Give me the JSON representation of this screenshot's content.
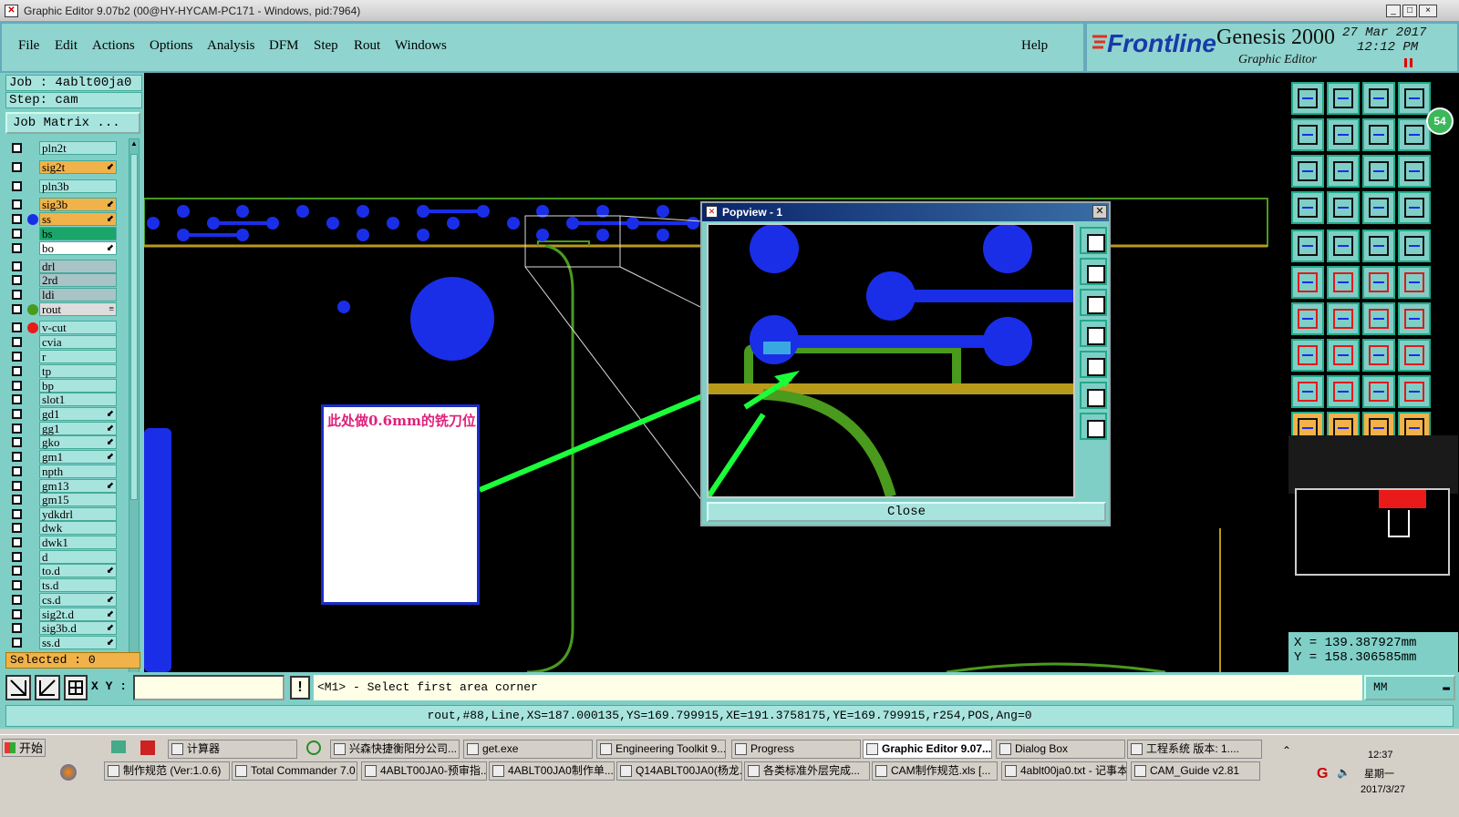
{
  "window": {
    "title": "Graphic Editor 9.07b2 (00@HY-HYCAM-PC171 - Windows, pid:7964)",
    "controls": [
      "_",
      "□",
      "×"
    ]
  },
  "menu": {
    "items": [
      "File",
      "Edit",
      "Actions",
      "Options",
      "Analysis",
      "DFM",
      "Step",
      "Rout",
      "Windows"
    ],
    "help": "Help"
  },
  "brand": {
    "logo": "Frontline",
    "product": "Genesis 2000",
    "subtitle": "Graphic Editor",
    "date": "27 Mar 2017",
    "time": "12:12 PM"
  },
  "job": {
    "job_label": "Job : 4ablt00ja0",
    "step_label": "Step: cam",
    "matrix_button": "Job Matrix ..."
  },
  "layers": [
    {
      "name": "pln2t",
      "style": "plain",
      "dot": "",
      "mark": ""
    },
    {
      "name": "sig2t",
      "style": "sig",
      "dot": "",
      "mark": "⬋"
    },
    {
      "name": "pln3b",
      "style": "plain",
      "dot": "",
      "mark": ""
    },
    {
      "name": "sig3b",
      "style": "sig",
      "dot": "",
      "mark": "⬋"
    },
    {
      "name": "ss",
      "style": "sig",
      "dot": "#1a2ee8",
      "mark": "⬋"
    },
    {
      "name": "bs",
      "style": "bs",
      "dot": "",
      "mark": ""
    },
    {
      "name": "bo",
      "style": "bo",
      "dot": "",
      "mark": "⬋"
    },
    {
      "name": "drl",
      "style": "drl",
      "dot": "",
      "mark": ""
    },
    {
      "name": "2rd",
      "style": "drl",
      "dot": "",
      "mark": ""
    },
    {
      "name": "ldi",
      "style": "drl",
      "dot": "",
      "mark": ""
    },
    {
      "name": "rout",
      "style": "rout",
      "dot": "#4a9a1e",
      "mark": "≡"
    },
    {
      "name": "v-cut",
      "style": "plain",
      "dot": "#e81a1a",
      "mark": ""
    },
    {
      "name": "cvia",
      "style": "plain",
      "dot": "",
      "mark": ""
    },
    {
      "name": "r",
      "style": "plain",
      "dot": "",
      "mark": ""
    },
    {
      "name": "tp",
      "style": "plain",
      "dot": "",
      "mark": ""
    },
    {
      "name": "bp",
      "style": "plain",
      "dot": "",
      "mark": ""
    },
    {
      "name": "slot1",
      "style": "plain",
      "dot": "",
      "mark": ""
    },
    {
      "name": "gd1",
      "style": "plain",
      "dot": "",
      "mark": "⬋"
    },
    {
      "name": "gg1",
      "style": "plain",
      "dot": "",
      "mark": "⬋"
    },
    {
      "name": "gko",
      "style": "plain",
      "dot": "",
      "mark": "⬋"
    },
    {
      "name": "gm1",
      "style": "plain",
      "dot": "",
      "mark": "⬋"
    },
    {
      "name": "npth",
      "style": "plain",
      "dot": "",
      "mark": ""
    },
    {
      "name": "gm13",
      "style": "plain",
      "dot": "",
      "mark": "⬋"
    },
    {
      "name": "gm15",
      "style": "plain",
      "dot": "",
      "mark": ""
    },
    {
      "name": "ydkdrl",
      "style": "plain",
      "dot": "",
      "mark": ""
    },
    {
      "name": "dwk",
      "style": "plain",
      "dot": "",
      "mark": ""
    },
    {
      "name": "dwk1",
      "style": "plain",
      "dot": "",
      "mark": ""
    },
    {
      "name": "d",
      "style": "plain",
      "dot": "",
      "mark": ""
    },
    {
      "name": "to.d",
      "style": "plain",
      "dot": "",
      "mark": "⬋"
    },
    {
      "name": "ts.d",
      "style": "plain",
      "dot": "",
      "mark": ""
    },
    {
      "name": "cs.d",
      "style": "plain",
      "dot": "",
      "mark": "⬋"
    },
    {
      "name": "sig2t.d",
      "style": "plain",
      "dot": "",
      "mark": "⬋"
    },
    {
      "name": "sig3b.d",
      "style": "plain",
      "dot": "",
      "mark": "⬋"
    },
    {
      "name": "ss.d",
      "style": "plain",
      "dot": "",
      "mark": "⬋"
    }
  ],
  "selected": "Selected : 0",
  "annotation": {
    "text": "此处做0.6mm的铣刀位"
  },
  "popview": {
    "title": "Popview - 1",
    "close_button": "Close"
  },
  "coords": {
    "x": "X = 139.387927mm",
    "y": "Y = 158.306585mm"
  },
  "badge": "54",
  "command": {
    "xy_label": "X Y :",
    "xy_value": "",
    "prompt": "<M1> - Select first area corner",
    "units": "MM"
  },
  "status": "rout,#88,Line,XS=187.000135,YS=169.799915,XE=191.3758175,YE=169.799915,r254,POS,Ang=0",
  "taskbar": {
    "start": "开始",
    "row1": [
      "计算器",
      "兴森快捷衡阳分公司...",
      "get.exe",
      "Engineering Toolkit 9....",
      "Progress",
      "Graphic Editor 9.07...",
      "Dialog Box",
      "工程系统  版本: 1...."
    ],
    "row2": [
      "制作规范 (Ver:1.0.6)",
      "Total Commander 7.0...",
      "4ABLT00JA0-预审指...",
      "4ABLT00JA0制作单....",
      "Q14ABLT00JA0(杨龙...",
      "各类标准外层完成...",
      "CAM制作规范.xls  [...",
      "4ablt00ja0.txt - 记事本",
      "CAM_Guide v2.81"
    ],
    "clock": "12:37",
    "weekday": "星期一",
    "date": "2017/3/27"
  },
  "colors": {
    "teal": "#7fcfc7",
    "pad_blue": "#1a2ee8",
    "rout_green": "#4a9a1e",
    "mask_gold": "#b89a1a",
    "arrow_green": "#1aff3a"
  }
}
